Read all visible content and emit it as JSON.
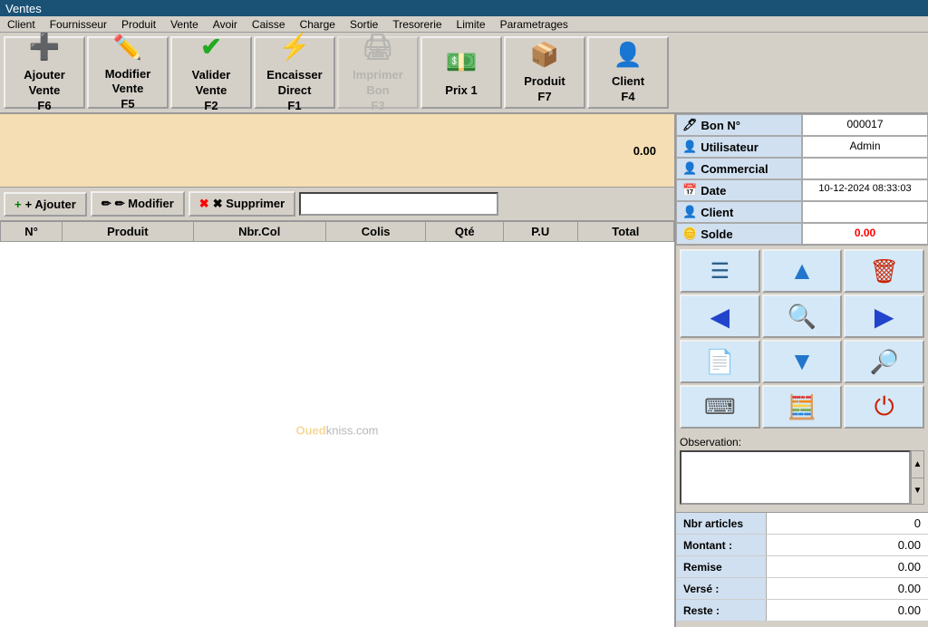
{
  "title": "Ventes",
  "menubar": {
    "items": [
      "Client",
      "Fournisseur",
      "Produit",
      "Vente",
      "Avoir",
      "Caisse",
      "Charge",
      "Sortie",
      "Tresorerie",
      "Limite",
      "Parametrages"
    ]
  },
  "toolbar": {
    "buttons": [
      {
        "id": "ajouter-vente",
        "icon": "➕",
        "line1": "Ajouter",
        "line2": "Vente",
        "shortcut": "F6",
        "disabled": false,
        "icon_color": "green"
      },
      {
        "id": "modifier-vente",
        "icon": "✏️",
        "line1": "Modifier",
        "line2": "Vente",
        "shortcut": "F5",
        "disabled": false
      },
      {
        "id": "valider-vente",
        "icon": "✔",
        "line1": "Valider",
        "line2": "Vente",
        "shortcut": "F2",
        "disabled": false
      },
      {
        "id": "encaisser-direct",
        "icon": "⚡",
        "line1": "Encaisser",
        "line2": "Direct",
        "shortcut": "F1",
        "disabled": false
      },
      {
        "id": "imprimer-bon",
        "icon": "🖨",
        "line1": "Imprimer",
        "line2": "Bon",
        "shortcut": "F3",
        "disabled": true
      },
      {
        "id": "prix1",
        "icon": "💵",
        "line1": "Prix 1",
        "line2": "",
        "shortcut": "",
        "disabled": false
      },
      {
        "id": "produit",
        "icon": "📦",
        "line1": "Produit",
        "line2": "",
        "shortcut": "F7",
        "disabled": false
      },
      {
        "id": "client",
        "icon": "👤",
        "line1": "Client",
        "line2": "",
        "shortcut": "F4",
        "disabled": false
      }
    ]
  },
  "amount_display": "0.00",
  "actions": {
    "ajouter_label": "+ Ajouter",
    "modifier_label": "✏ Modifier",
    "supprimer_label": "✖ Supprimer"
  },
  "table": {
    "columns": [
      "N°",
      "Produit",
      "Nbr.Col",
      "Colis",
      "Qté",
      "P.U",
      "Total"
    ],
    "rows": []
  },
  "watermark": "Ouedkniss.com",
  "info_panel": {
    "bon_n_label": "Bon N°",
    "bon_n_value": "000017",
    "utilisateur_label": "Utilisateur",
    "utilisateur_value": "Admin",
    "commercial_label": "Commercial",
    "commercial_value": "",
    "date_label": "Date",
    "date_value": "10-12-2024 08:33:03",
    "client_label": "Client",
    "client_value": "",
    "solde_label": "Solde",
    "solde_value": "0.00"
  },
  "icon_buttons": [
    {
      "id": "list-btn",
      "icon": "☰",
      "color": "icon-list",
      "title": "Liste"
    },
    {
      "id": "up-btn",
      "icon": "⬆",
      "color": "icon-up",
      "title": "Haut"
    },
    {
      "id": "delete-btn",
      "icon": "🗑",
      "color": "icon-del",
      "title": "Supprimer"
    },
    {
      "id": "back-btn",
      "icon": "⬅",
      "color": "icon-back",
      "title": "Précédent"
    },
    {
      "id": "search-btn",
      "icon": "🔍",
      "color": "icon-search",
      "title": "Chercher"
    },
    {
      "id": "forward-btn",
      "icon": "➡",
      "color": "icon-fwd",
      "title": "Suivant"
    },
    {
      "id": "doc-btn",
      "icon": "📄",
      "color": "icon-doc",
      "title": "Document"
    },
    {
      "id": "down-btn",
      "icon": "⬇",
      "color": "icon-down",
      "title": "Bas"
    },
    {
      "id": "zoom-btn",
      "icon": "🔎",
      "color": "icon-zoom",
      "title": "Zoom"
    },
    {
      "id": "keyboard-btn",
      "icon": "⌨",
      "color": "icon-kb",
      "title": "Clavier"
    },
    {
      "id": "calc-btn",
      "icon": "🧮",
      "color": "icon-calc",
      "title": "Calculatrice"
    },
    {
      "id": "power-btn",
      "icon": "⏻",
      "color": "icon-power",
      "title": "Fermer"
    }
  ],
  "observation": {
    "label": "Observation:",
    "value": ""
  },
  "summary": {
    "nbr_articles_label": "Nbr articles",
    "nbr_articles_value": "0",
    "montant_label": "Montant :",
    "montant_value": "0.00",
    "remise_label": "Remise",
    "remise_value": "0.00",
    "verse_label": "Versé :",
    "verse_value": "0.00",
    "reste_label": "Reste :",
    "reste_value": "0.00"
  }
}
